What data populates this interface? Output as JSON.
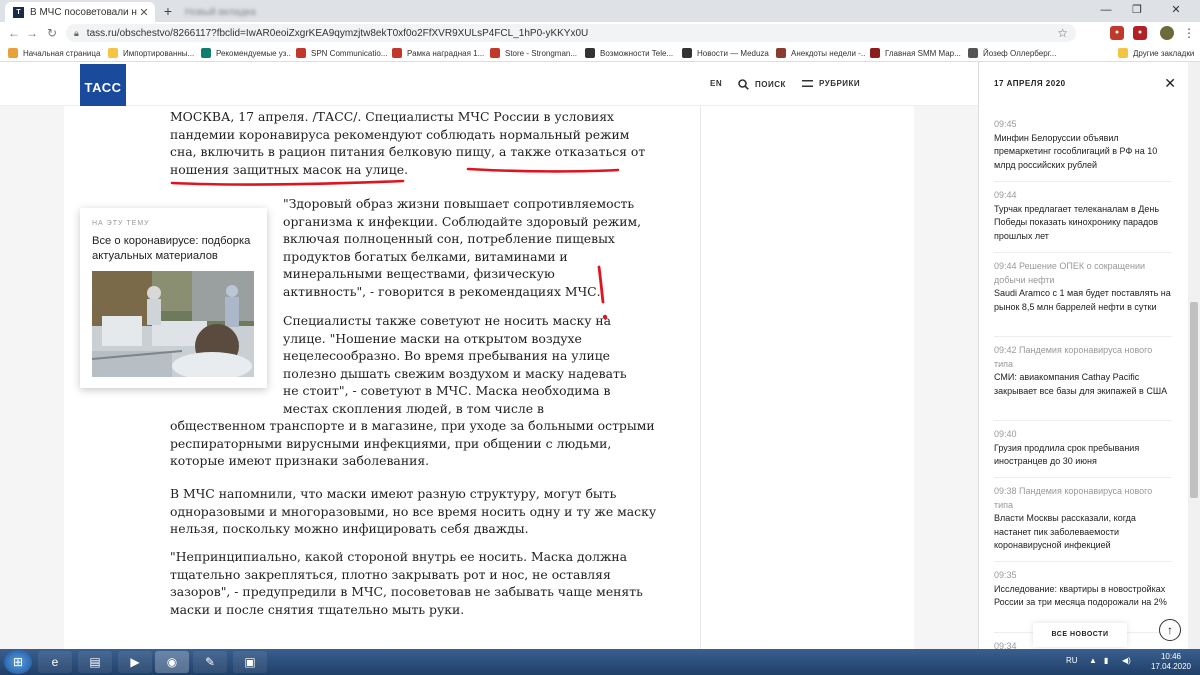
{
  "browser": {
    "active_tab_title": "В МЧС посоветовали не носить",
    "inactive_tab_title": "Новый вкладка",
    "favicon_text": "T",
    "new_tab_icon": "+",
    "url": "tass.ru/obschestvo/8266117?fbclid=IwAR0eoiZxgrKEA9qymzjtw8ekT0xf0o2FfXVR9XULsP4FCL_1hP0-yKKYx0U",
    "bookmarks": [
      "Начальная страница",
      "Импортированны...",
      "Рекомендуемые уз...",
      "SPN Communicatio...",
      "Рамка наградная 1...",
      "Store - Strongman...",
      "Возможности Tele...",
      "Новости — Meduza",
      "Анекдоты недели -...",
      "Главная SMM Map...",
      "Йозеф Оллерберг...",
      "Другие закладки"
    ],
    "bookmark_colors": [
      "#e9a23b",
      "#f6c445",
      "#0f7d6f",
      "#c0392b",
      "#c0392b",
      "#c0392b",
      "#333333",
      "#333333",
      "#8b3a2f",
      "#8b1d1d",
      "#555555",
      "#f6c445"
    ]
  },
  "site": {
    "logo": "ТАСС",
    "nav": {
      "lang": "EN",
      "search": "ПОИСК",
      "rubrics": "РУБРИКИ"
    },
    "accent_color": "#1a4a9c"
  },
  "article": {
    "lead_lines": [
      "МОСКВА, 17 апреля. /ТАСС/. Специалисты МЧС России в условиях",
      "пандемии коронавируса рекомендуют соблюдать нормальный режим",
      "сна, включить в рацион питания белковую пищу, а также отказаться от",
      "ношения защитных масок на улице."
    ],
    "quote_lines": [
      "\"Здоровый образ жизни повышает сопротивляемость",
      "организма к инфекции. Соблюдайте здоровый режим,",
      "включая полноценный сон, потребление пищевых",
      "продуктов богатых белками, витаминами и",
      "минеральными веществами, физическую",
      "активность\", - говорится в рекомендациях МЧС."
    ],
    "para2_lines": [
      "Специалисты также советуют не носить маску на",
      "улице. \"Ношение маски на открытом воздухе",
      "нецелесообразно. Во время пребывания на улице",
      "полезно дышать свежим воздухом и маску надевать",
      "не стоит\", - советуют в МЧС. Маска необходима в",
      "местах скопления людей, в том числе в",
      "общественном транспорте и в магазине, при уходе за больными острыми",
      "респираторными вирусными инфекциями, при общении с людьми,",
      "которые имеют признаки заболевания."
    ],
    "para3_lines": [
      "В МЧС напомнили, что маски имеют разную структуру, могут быть",
      "одноразовыми и многоразовыми, но все время носить одну и ту же маску",
      "нельзя, поскольку можно инфицировать себя дважды."
    ],
    "para4_lines": [
      "\"Непринципиально, какой стороной внутрь ее носить. Маска должна",
      "тщательно закрепляться, плотно закрывать рот и нос, не оставляя",
      "зазоров\", - предупредили в МЧС, посоветовав не забывать чаще менять",
      "маски и после снятия тщательно мыть руки."
    ],
    "annotation_mark": "!",
    "annotation_color": "#e0141e"
  },
  "related_card": {
    "kicker": "НА ЭТУ ТЕМУ",
    "title": "Все о коронавирусе: подборка актуальных материалов"
  },
  "news_panel": {
    "date": "17 АПРЕЛЯ 2020",
    "close_icon": "✕",
    "items": [
      {
        "time": "09:45",
        "tag": "",
        "headline": "Минфин Белоруссии объявил премаркетинг гособлигаций в РФ на 10 млрд российских рублей"
      },
      {
        "time": "09:44",
        "tag": "",
        "headline": "Турчак предлагает телеканалам в День Победы показать кинохронику парадов прошлых лет"
      },
      {
        "time": "09:44",
        "tag": "Решение ОПЕК о сокращении добычи нефти",
        "headline": "Saudi Aramco с 1 мая будет поставлять на рынок 8,5 млн баррелей нефти в сутки"
      },
      {
        "time": "09:42",
        "tag": "Пандемия коронавируса нового типа",
        "headline": "СМИ: авиакомпания Cathay Pacific закрывает все базы для экипажей в США"
      },
      {
        "time": "09:40",
        "tag": "",
        "headline": "Грузия продлила срок пребывания иностранцев до 30 июня"
      },
      {
        "time": "09:38",
        "tag": "Пандемия коронавируса нового типа",
        "headline": "Власти Москвы рассказали, когда настанет пик заболеваемости коронавирусной инфекцией"
      },
      {
        "time": "09:35",
        "tag": "",
        "headline": "Исследование: квартиры в новостройках России за три месяца подорожали на 2%"
      },
      {
        "time": "09:34",
        "tag": "",
        "headline": ""
      }
    ],
    "all_news": "ВСЕ НОВОСТИ",
    "to_top_icon": "↑"
  },
  "taskbar": {
    "lang": "RU",
    "time": "10:46",
    "date": "17.04.2020"
  }
}
